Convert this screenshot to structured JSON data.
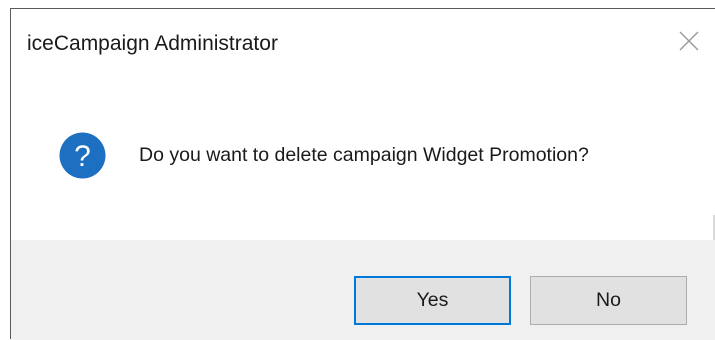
{
  "dialog": {
    "title": "iceCampaign Administrator",
    "close_icon": "close-icon",
    "message_icon": "question-icon",
    "message": "Do you want to delete campaign Widget Promotion?",
    "buttons": {
      "yes_label": "Yes",
      "no_label": "No"
    }
  },
  "colors": {
    "question_icon_fill": "#1c6fc1",
    "default_button_border": "#0078d7",
    "footer_background": "#f0f0f0"
  }
}
